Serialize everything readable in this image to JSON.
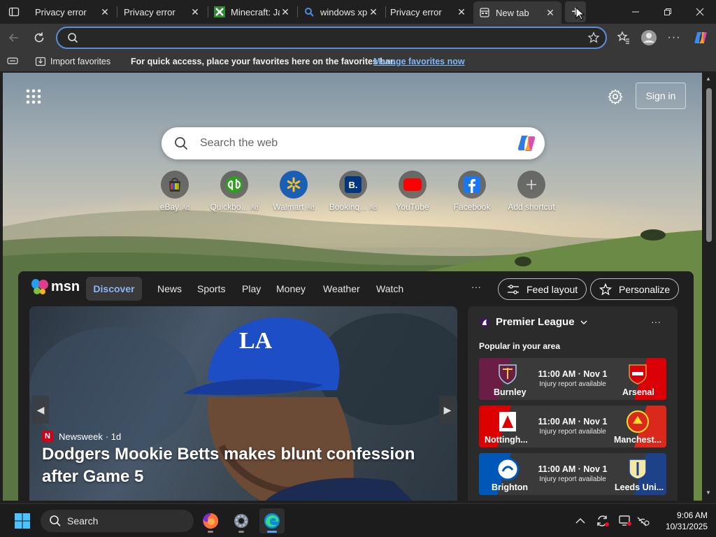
{
  "browser": {
    "tabs": [
      {
        "title": "Privacy error",
        "icon": "page-icon"
      },
      {
        "title": "Privacy error",
        "icon": "page-icon"
      },
      {
        "title": "Minecraft: Ja",
        "icon": "minecraft-icon"
      },
      {
        "title": "windows xp",
        "icon": "search-icon"
      },
      {
        "title": "Privacy error",
        "icon": "page-icon"
      },
      {
        "title": "New tab",
        "icon": "newtab-icon"
      }
    ],
    "new_tab_symbol": "+",
    "address_value": "",
    "favorites_bar": {
      "import_label": "Import favorites",
      "message": "For quick access, place your favorites here on the favorites bar.",
      "manage_link": "Manage favorites now"
    }
  },
  "newtab": {
    "signin_label": "Sign in",
    "search_placeholder": "Search the web",
    "shortcuts": [
      {
        "label": "eBay",
        "ad": "Ad",
        "icon": "ebay-icon"
      },
      {
        "label": "Quickbo...",
        "ad": "Ad",
        "icon": "quickbooks-icon"
      },
      {
        "label": "Walmart",
        "ad": "Ad",
        "icon": "walmart-icon"
      },
      {
        "label": "Bookinq...",
        "ad": "Ad",
        "icon": "booking-icon"
      },
      {
        "label": "YouTube",
        "ad": "",
        "icon": "youtube-icon"
      },
      {
        "label": "Facebook",
        "ad": "",
        "icon": "facebook-icon"
      },
      {
        "label": "Add shortcut",
        "ad": "",
        "icon": "plus-icon"
      }
    ]
  },
  "feed": {
    "logo_text": "msn",
    "nav": [
      "Discover",
      "News",
      "Sports",
      "Play",
      "Money",
      "Weather",
      "Watch"
    ],
    "more": "···",
    "feed_layout_label": "Feed layout",
    "personalize_label": "Personalize",
    "hero": {
      "source": "Newsweek",
      "age": "· 1d",
      "headline": "Dodgers Mookie Betts makes blunt confession after Game 5"
    },
    "league": {
      "title": "Premier League",
      "subtitle": "Popular in your area",
      "matches": [
        {
          "home": "Burnley",
          "away": "Arsenal",
          "time": "11:00 AM · Nov 1",
          "note": "Injury report available",
          "home_color": "#6c1d45",
          "away_color": "#db0007"
        },
        {
          "home": "Nottingh...",
          "away": "Manchest...",
          "time": "11:00 AM · Nov 1",
          "note": "Injury report available",
          "home_color": "#dd0000",
          "away_color": "#da291c"
        },
        {
          "home": "Brighton",
          "away": "Leeds Uni...",
          "time": "11:00 AM · Nov 1",
          "note": "Injury report available",
          "home_color": "#0057b8",
          "away_color": "#1d428a"
        }
      ]
    }
  },
  "taskbar": {
    "search_label": "Search",
    "time": "9:06 AM",
    "date": "10/31/2025"
  }
}
